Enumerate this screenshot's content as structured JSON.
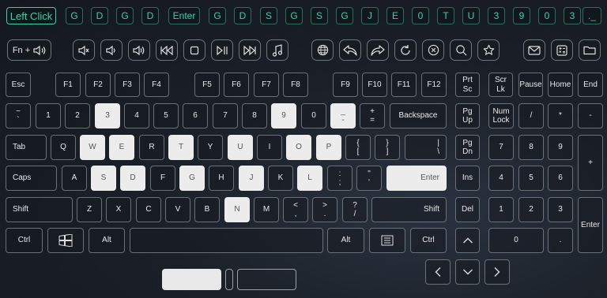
{
  "history": {
    "items": [
      "Left Click",
      "G",
      "D",
      "G",
      "D",
      "Enter",
      "G",
      "D",
      "S",
      "G",
      "S",
      "G",
      "J",
      "E",
      "0",
      "T",
      "U",
      "3",
      "9",
      "0",
      "3",
      "._"
    ]
  },
  "media": {
    "fn_label": "Fn +",
    "buttons": [
      "volume-mute-icon",
      "volume-down-icon",
      "volume-up-icon",
      "previous-track-icon",
      "stop-icon",
      "play-pause-icon",
      "next-track-icon",
      "music-icon",
      "globe-icon",
      "back-icon",
      "forward-icon",
      "refresh-icon",
      "close-circle-icon",
      "search-icon",
      "star-icon",
      "mail-icon",
      "calculator-icon",
      "folder-icon"
    ]
  },
  "keys": {
    "esc": "Esc",
    "f1": "F1",
    "f2": "F2",
    "f3": "F3",
    "f4": "F4",
    "f5": "F5",
    "f6": "F6",
    "f7": "F7",
    "f8": "F8",
    "f9": "F9",
    "f10": "F10",
    "f11": "F11",
    "f12": "F12",
    "prtsc_1": "Prt",
    "prtsc_2": "Sc",
    "scrlk_1": "Scr",
    "scrlk_2": "Lk",
    "pause": "Pause",
    "home": "Home",
    "end": "End",
    "tilde_1": "~",
    "tilde_2": "`",
    "n1": "1",
    "n2": "2",
    "n3": "3",
    "n4": "4",
    "n5": "5",
    "n6": "6",
    "n7": "7",
    "n8": "8",
    "n9": "9",
    "n0": "0",
    "minus_1": "_",
    "minus_2": "-",
    "plus_1": "+",
    "plus_2": "=",
    "backspace": "Backspace",
    "pgup_1": "Pg",
    "pgup_2": "Up",
    "numlock_1": "Num",
    "numlock_2": "Lock",
    "np_div": "/",
    "np_mul": "*",
    "np_sub": "-",
    "tab": "Tab",
    "q": "Q",
    "w": "W",
    "e": "E",
    "r": "R",
    "t": "T",
    "y": "Y",
    "u": "U",
    "i": "I",
    "o": "O",
    "p": "P",
    "lbr_1": "{",
    "lbr_2": "[",
    "rbr_1": "}",
    "rbr_2": "]",
    "bsl_1": "|",
    "bsl_2": "\\",
    "pgdn_1": "Pg",
    "pgdn_2": "Dn",
    "np7": "7",
    "np8": "8",
    "np9": "9",
    "np_add": "+",
    "caps": "Caps",
    "a": "A",
    "s": "S",
    "d": "D",
    "f": "F",
    "g": "G",
    "h": "H",
    "j": "J",
    "k": "K",
    "l": "L",
    "semi_1": ":",
    "semi_2": ";",
    "quote_1": "\"",
    "quote_2": "'",
    "enter": "Enter",
    "ins": "Ins",
    "np4": "4",
    "np5": "5",
    "np6": "6",
    "lshift": "Shift",
    "z": "Z",
    "x": "X",
    "c": "C",
    "v": "V",
    "b": "B",
    "n": "N",
    "m": "M",
    "comma_1": "<",
    "comma_2": ",",
    "period_1": ">",
    "period_2": ".",
    "slash_1": "?",
    "slash_2": "/",
    "rshift": "Shift",
    "del": "Del",
    "np1": "1",
    "np2": "2",
    "np3": "3",
    "np_enter": "Enter",
    "lctrl": "Ctrl",
    "lalt": "Alt",
    "ralt": "Alt",
    "rctrl": "Ctrl",
    "np0": "0",
    "np_dot": "."
  }
}
